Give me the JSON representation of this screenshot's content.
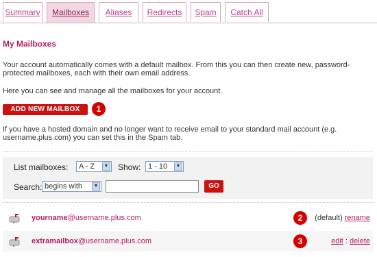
{
  "tabs": [
    {
      "label": "Summary",
      "active": false
    },
    {
      "label": "Mailboxes",
      "active": true
    },
    {
      "label": "Aliases",
      "active": false
    },
    {
      "label": "Redirects",
      "active": false
    },
    {
      "label": "Spam",
      "active": false
    },
    {
      "label": "Catch All",
      "active": false
    }
  ],
  "page_title": "My Mailboxes",
  "intro": {
    "line1": "Your account automatically comes with a default mailbox. From this you can then create new, password-",
    "line2": "protected mailboxes, each with their own email address.",
    "line3": "Here you can see and manage all the mailboxes for your account."
  },
  "add_button_label": "ADD NEW MAILBOX",
  "badges": {
    "one": "1",
    "two": "2",
    "three": "3"
  },
  "hosted_note": {
    "line1": "If you have a hosted domain and no longer want to receive email to your standard mail account (e.g.",
    "line2": "username.plus.com) you can set this in the Spam tab."
  },
  "filters": {
    "list_label": "List mailboxes:",
    "sort_value": "A - Z",
    "show_label": "Show:",
    "range_value": "1 - 10",
    "search_label": "Search:",
    "search_mode": "begins with",
    "search_value": "",
    "go_label": "GO"
  },
  "mailboxes": [
    {
      "name": "yourname",
      "domain": "@username.plus.com",
      "default_label": "(default)",
      "rename_label": "rename"
    },
    {
      "name": "extramailbox",
      "domain": "@username.plus.com",
      "edit_label": "edit",
      "separator": ":",
      "delete_label": "delete"
    }
  ],
  "colors": {
    "accent": "#b02067",
    "button_red": "#cc1111",
    "tab_active_bg": "#f3d7e3"
  }
}
